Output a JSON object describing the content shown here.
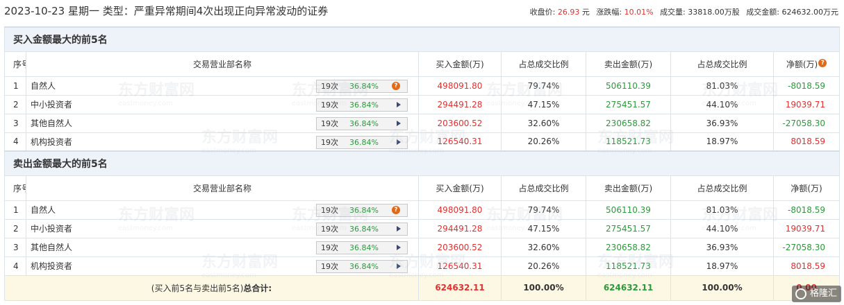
{
  "header": {
    "title": "2023-10-23 星期一 类型：严重异常期间4次出现正向异常波动的证券",
    "close_label": "收盘价:",
    "close_value": "26.93",
    "close_unit": "元",
    "change_label": "涨跌幅:",
    "change_value": "10.01%",
    "volume_label": "成交量:",
    "volume_value": "33818.00万股",
    "amount_label": "成交金额:",
    "amount_value": "624632.00万元"
  },
  "columns": {
    "idx": "序号",
    "dept": "交易营业部名称",
    "buy": "买入金额(万)",
    "buy_ratio": "占总成交比例",
    "sell": "卖出金额(万)",
    "sell_ratio": "占总成交比例",
    "net": "净额(万)"
  },
  "buy_section": {
    "title": "买入金额最大的前5名",
    "rows": [
      {
        "idx": "1",
        "name": "自然人",
        "count": "19次",
        "pct": "36.84%",
        "icon": "question-icon",
        "buy": "498091.80",
        "buy_ratio": "79.74%",
        "sell": "506110.39",
        "sell_ratio": "81.03%",
        "net": "-8018.59",
        "net_color": "#2a9a3a"
      },
      {
        "idx": "2",
        "name": "中小投资者",
        "count": "19次",
        "pct": "36.84%",
        "icon": "arrow-right-icon",
        "buy": "294491.28",
        "buy_ratio": "47.15%",
        "sell": "275451.57",
        "sell_ratio": "44.10%",
        "net": "19039.71",
        "net_color": "#e03030"
      },
      {
        "idx": "3",
        "name": "其他自然人",
        "count": "19次",
        "pct": "36.84%",
        "icon": "arrow-right-icon",
        "buy": "203600.52",
        "buy_ratio": "32.60%",
        "sell": "230658.82",
        "sell_ratio": "36.93%",
        "net": "-27058.30",
        "net_color": "#2a9a3a"
      },
      {
        "idx": "4",
        "name": "机构投资者",
        "count": "19次",
        "pct": "36.84%",
        "icon": "arrow-right-icon",
        "buy": "126540.31",
        "buy_ratio": "20.26%",
        "sell": "118521.73",
        "sell_ratio": "18.97%",
        "net": "8018.59",
        "net_color": "#e03030"
      }
    ]
  },
  "sell_section": {
    "title": "卖出金额最大的前5名",
    "rows": [
      {
        "idx": "1",
        "name": "自然人",
        "count": "19次",
        "pct": "36.84%",
        "icon": "question-icon",
        "buy": "498091.80",
        "buy_ratio": "79.74%",
        "sell": "506110.39",
        "sell_ratio": "81.03%",
        "net": "-8018.59",
        "net_color": "#2a9a3a"
      },
      {
        "idx": "2",
        "name": "中小投资者",
        "count": "19次",
        "pct": "36.84%",
        "icon": "arrow-right-icon",
        "buy": "294491.28",
        "buy_ratio": "47.15%",
        "sell": "275451.57",
        "sell_ratio": "44.10%",
        "net": "19039.71",
        "net_color": "#e03030"
      },
      {
        "idx": "3",
        "name": "其他自然人",
        "count": "19次",
        "pct": "36.84%",
        "icon": "arrow-right-icon",
        "buy": "203600.52",
        "buy_ratio": "32.60%",
        "sell": "230658.82",
        "sell_ratio": "36.93%",
        "net": "-27058.30",
        "net_color": "#2a9a3a"
      },
      {
        "idx": "4",
        "name": "机构投资者",
        "count": "19次",
        "pct": "36.84%",
        "icon": "arrow-right-icon",
        "buy": "126540.31",
        "buy_ratio": "20.26%",
        "sell": "118521.73",
        "sell_ratio": "18.97%",
        "net": "8018.59",
        "net_color": "#e03030"
      }
    ]
  },
  "total": {
    "label_prefix": "(买入前5名与卖出前5名)",
    "label_bold": "总合计:",
    "buy": "624632.11",
    "buy_ratio": "100.00%",
    "sell": "624632.11",
    "sell_ratio": "100.00%",
    "net": "0.00"
  },
  "watermark": {
    "text": "东方财富网",
    "subtext": "eastmoney.com"
  },
  "corner_logo": "格隆汇",
  "colors": {
    "red": "#e03030",
    "green": "#2a9a3a",
    "section_bg": "#eef3f9",
    "total_bg": "#fcf8e3",
    "icon_orange": "#e06a1a"
  }
}
